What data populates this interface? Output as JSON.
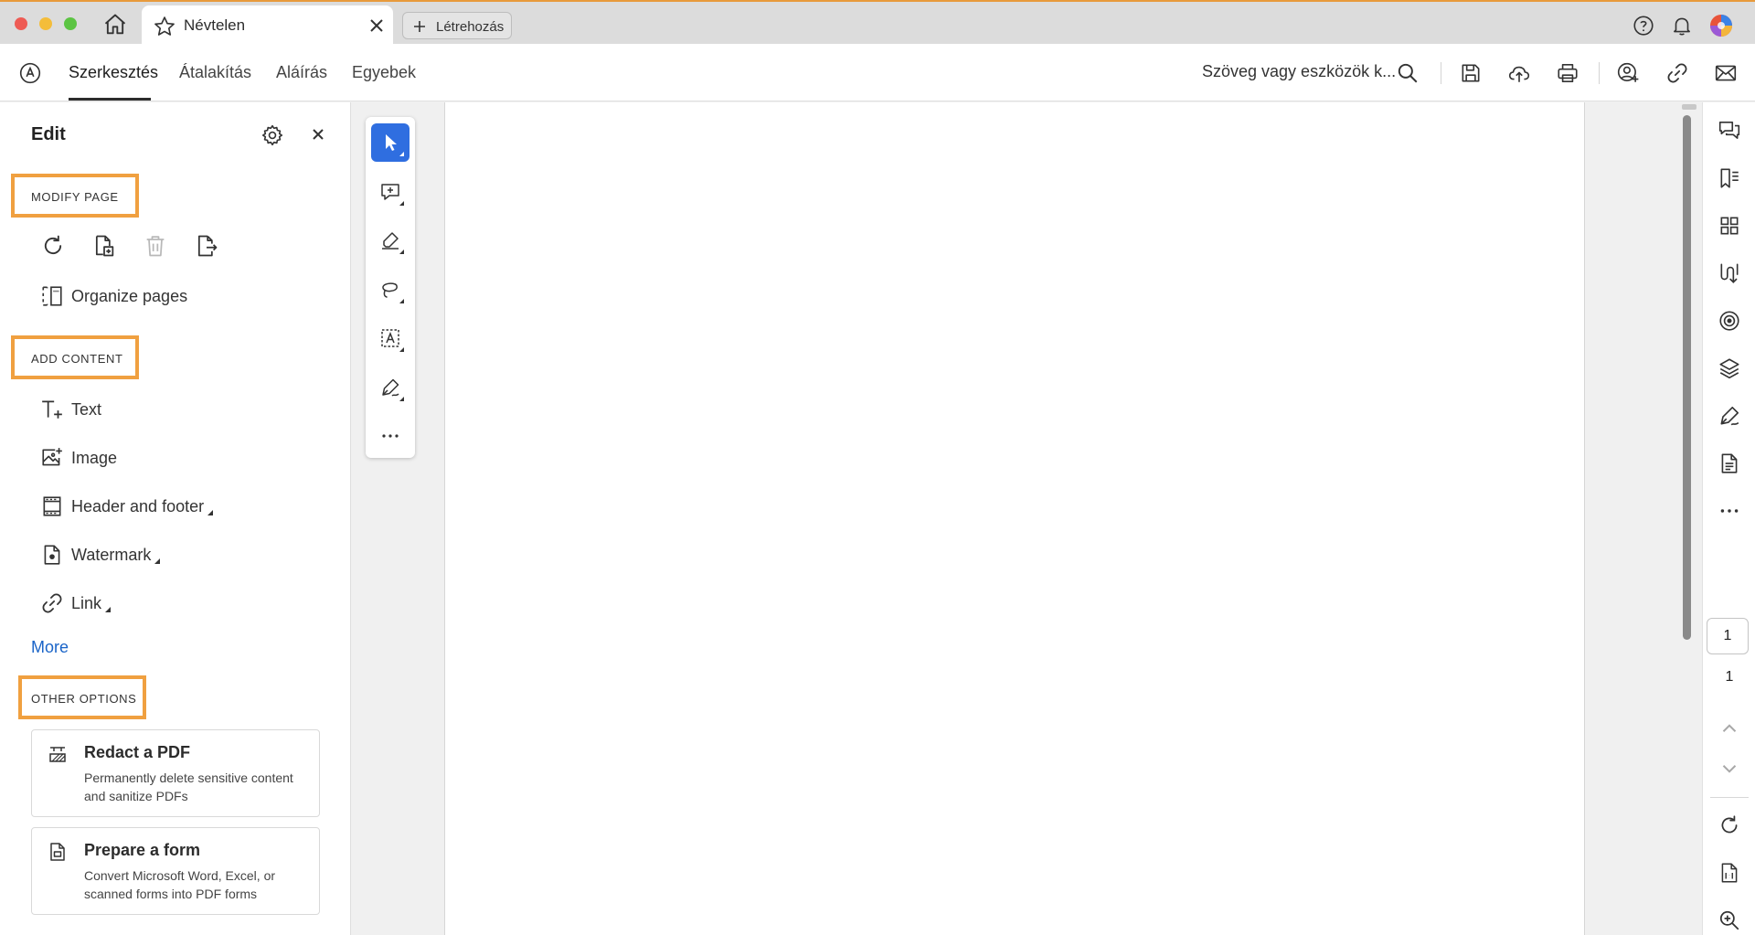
{
  "window": {
    "tab_title": "Névtelen",
    "new_tab_label": "Létrehozás"
  },
  "menubar": {
    "tabs": [
      {
        "label": "Szerkesztés",
        "active": true
      },
      {
        "label": "Átalakítás",
        "active": false
      },
      {
        "label": "Aláírás",
        "active": false
      },
      {
        "label": "Egyebek",
        "active": false
      }
    ],
    "search_placeholder": "Szöveg vagy eszközök k..."
  },
  "panel": {
    "title": "Edit",
    "modify_page": {
      "heading": "MODIFY PAGE",
      "icons": [
        "rotate-icon",
        "insert-page-icon",
        "delete-page-icon",
        "extract-page-icon"
      ],
      "organize_label": "Organize pages"
    },
    "add_content": {
      "heading": "ADD CONTENT",
      "items": [
        {
          "label": "Text",
          "icon": "add-text-icon",
          "submenu": false
        },
        {
          "label": "Image",
          "icon": "add-image-icon",
          "submenu": false
        },
        {
          "label": "Header and footer",
          "icon": "header-footer-icon",
          "submenu": true
        },
        {
          "label": "Watermark",
          "icon": "watermark-icon",
          "submenu": true
        },
        {
          "label": "Link",
          "icon": "link-icon",
          "submenu": true
        }
      ],
      "more_label": "More"
    },
    "other_options": {
      "heading": "OTHER OPTIONS",
      "cards": [
        {
          "title": "Redact a PDF",
          "description": "Permanently delete sensitive content and sanitize PDFs",
          "icon": "redact-icon"
        },
        {
          "title": "Prepare a form",
          "description": "Convert Microsoft Word, Excel, or scanned forms into PDF forms",
          "icon": "form-icon"
        }
      ]
    }
  },
  "toolstrip": {
    "tools": [
      "select-tool-icon",
      "add-comment-icon",
      "highlight-icon",
      "draw-freeform-icon",
      "text-recognition-icon",
      "fill-sign-icon",
      "more-tools-icon"
    ]
  },
  "page_nav": {
    "current_page": "1",
    "total_pages": "1"
  },
  "colors": {
    "accent_blue": "#2f6ee0",
    "highlight_orange": "#f0a040",
    "link_blue": "#1a64c8"
  }
}
